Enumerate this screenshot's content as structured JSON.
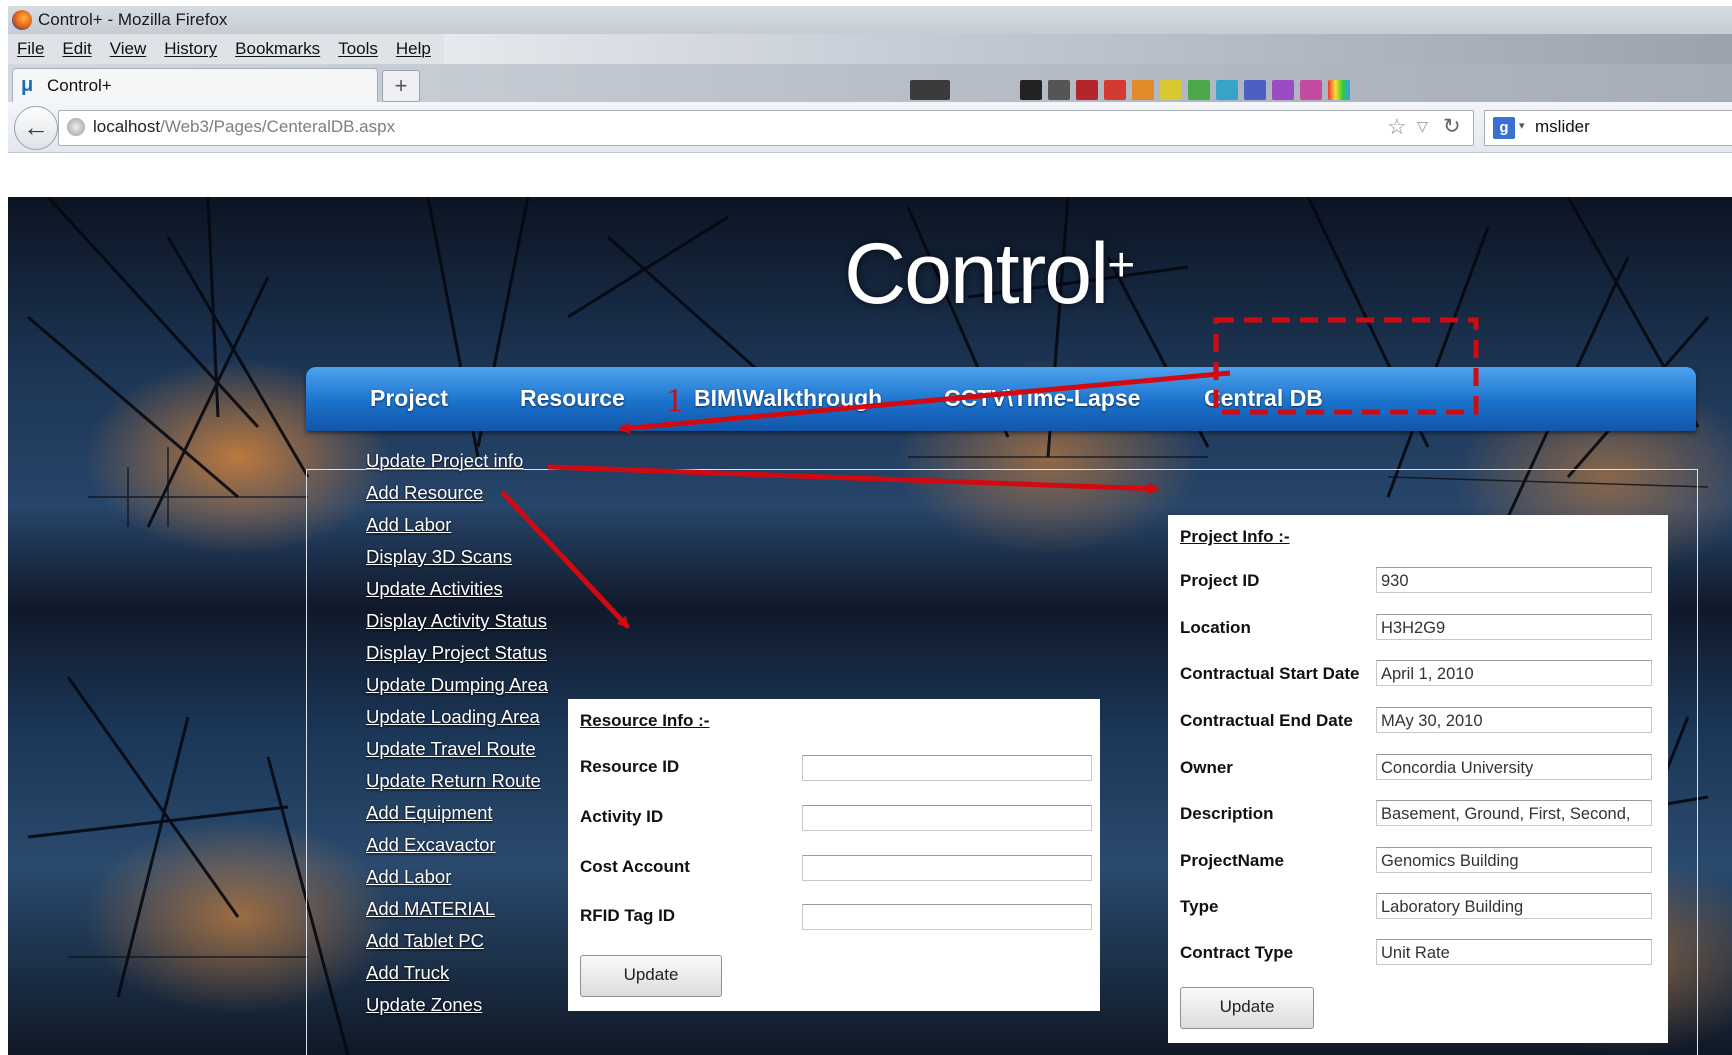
{
  "window": {
    "title": "Control+ - Mozilla Firefox"
  },
  "menu": {
    "items": [
      "File",
      "Edit",
      "View",
      "History",
      "Bookmarks",
      "Tools",
      "Help"
    ]
  },
  "tab": {
    "label": "Control+",
    "new_tab": "+"
  },
  "address": {
    "host": "localhost",
    "path": "/Web3/Pages/CenteralDB.aspx"
  },
  "search": {
    "engine_icon": "g",
    "value": "mslider"
  },
  "site": {
    "logo": "Control",
    "logo_plus": "+",
    "nav": [
      "Project",
      "Resource",
      "BIM\\Walkthrough",
      "CCTV\\Time-Lapse",
      "Central DB"
    ]
  },
  "sidebar": {
    "links": [
      "Update Project info",
      "Add Resource",
      "Add Labor",
      "Display 3D Scans",
      "Update Activities",
      "Display Activity Status",
      "Display Project Status",
      "Update Dumping Area",
      "Update Loading Area",
      "Update Travel Route",
      "Update Return Route",
      "Add Equipment",
      "Add Excavactor",
      "Add Labor",
      "Add MATERIAL",
      "Add Tablet PC",
      "Add Truck",
      "Update Zones"
    ]
  },
  "resource_info": {
    "title": "Resource Info :-",
    "fields": [
      {
        "label": "Resource ID",
        "value": ""
      },
      {
        "label": "Activity ID",
        "value": ""
      },
      {
        "label": "Cost Account",
        "value": ""
      },
      {
        "label": "RFID Tag ID",
        "value": ""
      }
    ],
    "button": "Update"
  },
  "project_info": {
    "title": "Project Info :-",
    "fields": [
      {
        "label": "Project ID",
        "value": "930"
      },
      {
        "label": "Location",
        "value": "H3H2G9"
      },
      {
        "label": "Contractual Start Date",
        "value": "April 1, 2010"
      },
      {
        "label": "Contractual End Date",
        "value": "MAy 30, 2010"
      },
      {
        "label": "Owner",
        "value": "Concordia University"
      },
      {
        "label": "Description",
        "value": "Basement, Ground, First, Second,"
      },
      {
        "label": "ProjectName",
        "value": "Genomics Building"
      },
      {
        "label": "Type",
        "value": "Laboratory Building"
      },
      {
        "label": "Contract Type",
        "value": "Unit Rate"
      }
    ],
    "button": "Update"
  },
  "annotation": {
    "marker": "1",
    "color": "#d10a12"
  },
  "colors": {
    "nav_blue": "#1b72cc",
    "annotation_red": "#d10a12"
  }
}
